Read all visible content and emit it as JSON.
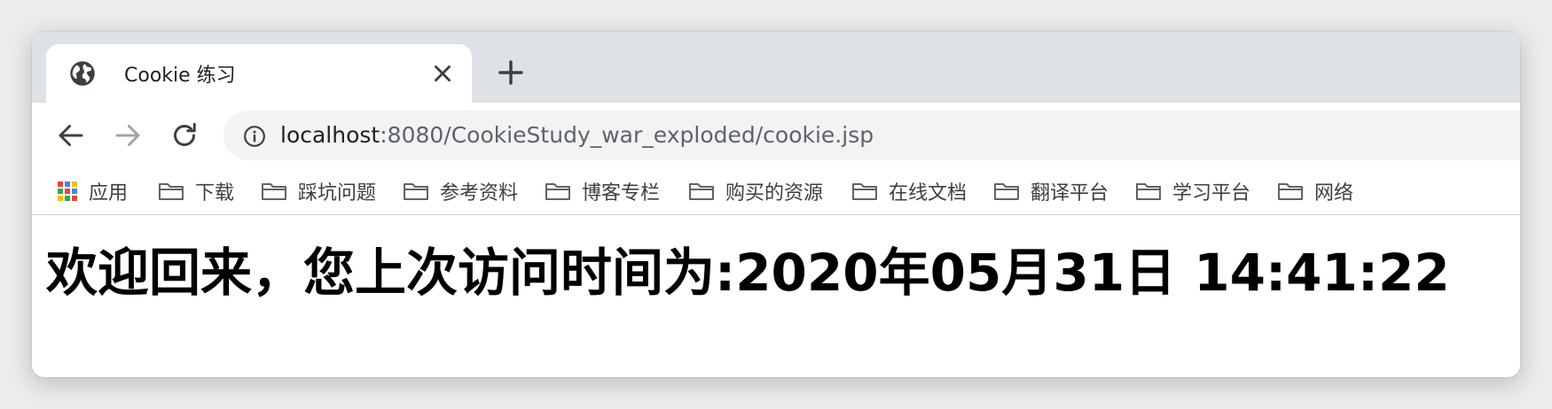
{
  "tab": {
    "title": "Cookie 练习",
    "favicon": "globe-icon"
  },
  "omnibox": {
    "host": "localhost",
    "path": ":8080/CookieStudy_war_exploded/cookie.jsp"
  },
  "bookmarks": {
    "apps_label": "应用",
    "items": [
      {
        "label": "下载"
      },
      {
        "label": "踩坑问题"
      },
      {
        "label": "参考资料"
      },
      {
        "label": "博客专栏"
      },
      {
        "label": "购买的资源"
      },
      {
        "label": "在线文档"
      },
      {
        "label": "翻译平台"
      },
      {
        "label": "学习平台"
      },
      {
        "label": "网络"
      }
    ]
  },
  "page": {
    "heading": "欢迎回来，您上次访问时间为:2020年05月31日 14:41:22"
  },
  "colors": {
    "tabstrip": "#dee1e6",
    "omnibox": "#f1f3f4",
    "text": "#202124",
    "muted": "#5f6368",
    "folder": "#5f6368"
  }
}
